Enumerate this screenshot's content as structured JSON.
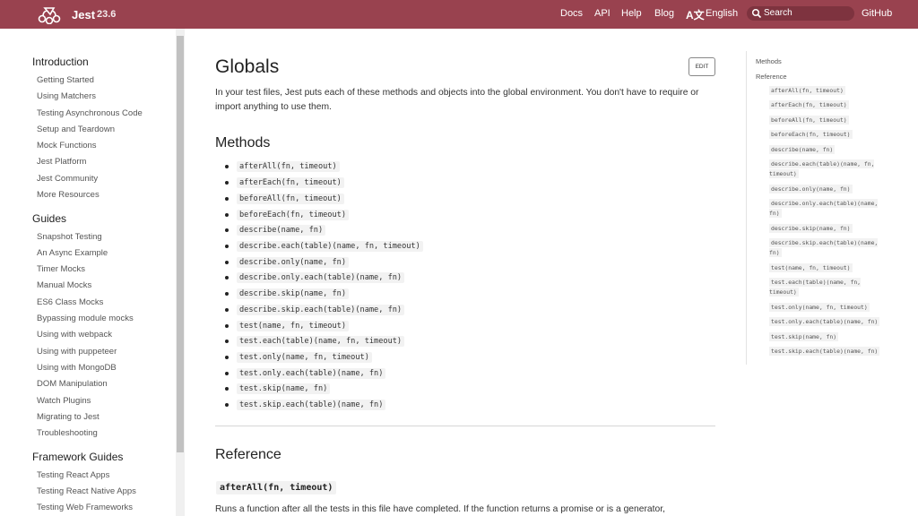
{
  "header": {
    "brand": "Jest",
    "version": "23.6",
    "nav": [
      "Docs",
      "API",
      "Help",
      "Blog"
    ],
    "language_icon": "translate-icon",
    "language": "English",
    "search_placeholder": "Search",
    "github": "GitHub",
    "colors": {
      "bar": "#99424f",
      "search_bg": "#7e333f"
    }
  },
  "sidebar": {
    "sections": [
      {
        "title": "Introduction",
        "items": [
          "Getting Started",
          "Using Matchers",
          "Testing Asynchronous Code",
          "Setup and Teardown",
          "Mock Functions",
          "Jest Platform",
          "Jest Community",
          "More Resources"
        ]
      },
      {
        "title": "Guides",
        "items": [
          "Snapshot Testing",
          "An Async Example",
          "Timer Mocks",
          "Manual Mocks",
          "ES6 Class Mocks",
          "Bypassing module mocks",
          "Using with webpack",
          "Using with puppeteer",
          "Using with MongoDB",
          "DOM Manipulation",
          "Watch Plugins",
          "Migrating to Jest",
          "Troubleshooting"
        ]
      },
      {
        "title": "Framework Guides",
        "items": [
          "Testing React Apps",
          "Testing React Native Apps",
          "Testing Web Frameworks"
        ]
      }
    ]
  },
  "main": {
    "title": "Globals",
    "edit_label": "EDIT",
    "intro": "In your test files, Jest puts each of these methods and objects into the global environment. You don't have to require or import anything to use them.",
    "methods_heading": "Methods",
    "methods": [
      "afterAll(fn, timeout)",
      "afterEach(fn, timeout)",
      "beforeAll(fn, timeout)",
      "beforeEach(fn, timeout)",
      "describe(name, fn)",
      "describe.each(table)(name, fn, timeout)",
      "describe.only(name, fn)",
      "describe.only.each(table)(name, fn)",
      "describe.skip(name, fn)",
      "describe.skip.each(table)(name, fn)",
      "test(name, fn, timeout)",
      "test.each(table)(name, fn, timeout)",
      "test.only(name, fn, timeout)",
      "test.only.each(table)(name, fn)",
      "test.skip(name, fn)",
      "test.skip.each(table)(name, fn)"
    ],
    "reference_heading": "Reference",
    "reference_first": "afterAll(fn, timeout)",
    "reference_desc": "Runs a function after all the tests in this file have completed. If the function returns a promise or is a generator,"
  },
  "toc": {
    "methods_link": "Methods",
    "reference_link": "Reference",
    "items": [
      "afterAll(fn, timeout)",
      "afterEach(fn, timeout)",
      "beforeAll(fn, timeout)",
      "beforeEach(fn, timeout)",
      "describe(name, fn)",
      "describe.each(table)(name, fn, timeout)",
      "describe.only(name, fn)",
      "describe.only.each(table)(name, fn)",
      "describe.skip(name, fn)",
      "describe.skip.each(table)(name, fn)",
      "test(name, fn, timeout)",
      "test.each(table)(name, fn, timeout)",
      "test.only(name, fn, timeout)",
      "test.only.each(table)(name, fn)",
      "test.skip(name, fn)",
      "test.skip.each(table)(name, fn)"
    ]
  }
}
